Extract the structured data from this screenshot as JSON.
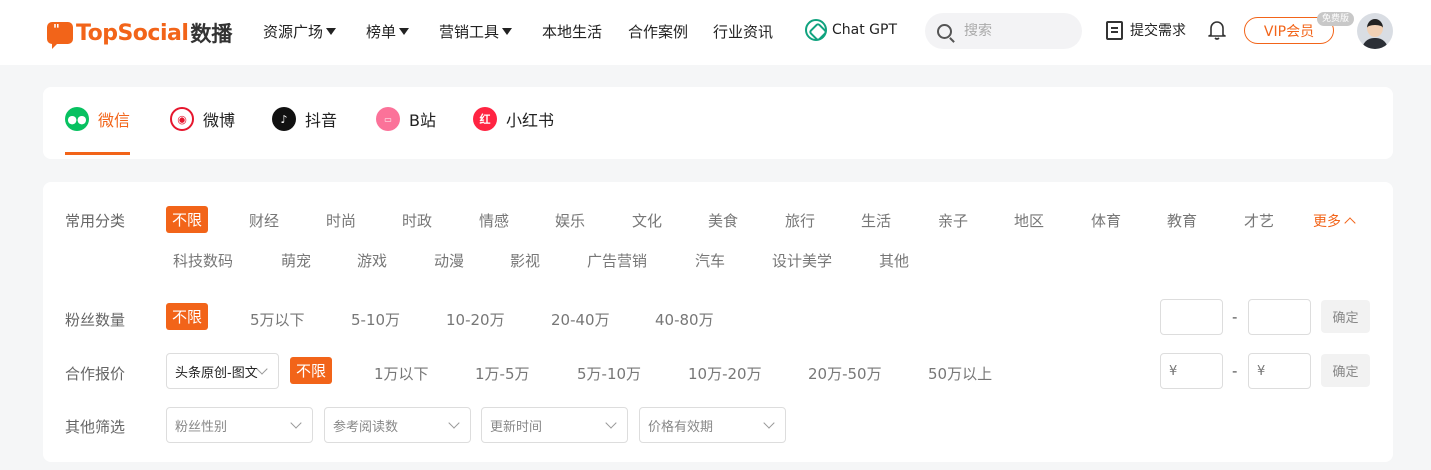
{
  "header": {
    "logo_mark": "\"",
    "logo_text": "TopSocial",
    "logo_sub": "数播",
    "nav": [
      "资源广场",
      "榜单",
      "营销工具",
      "本地生活",
      "合作案例",
      "行业资讯"
    ],
    "chatgpt": "Chat GPT",
    "search_placeholder": "搜索",
    "submit_label": "提交需求",
    "vip_label": "VIP会员",
    "vip_badge": "免费版"
  },
  "platform_tabs": [
    {
      "label": "微信",
      "icon": "wechat-icon",
      "color": "#07c160"
    },
    {
      "label": "微博",
      "icon": "weibo-icon",
      "color": "#e6162d"
    },
    {
      "label": "抖音",
      "icon": "douyin-icon",
      "color": "#111111"
    },
    {
      "label": "B站",
      "icon": "bilibili-icon",
      "color": "#fb7299"
    },
    {
      "label": "小红书",
      "icon": "xiaohongshu-icon",
      "color": "#ff2442"
    }
  ],
  "filters": {
    "category_label": "常用分类",
    "categories_row1": [
      "不限",
      "财经",
      "时尚",
      "时政",
      "情感",
      "娱乐",
      "文化",
      "美食",
      "旅行",
      "生活",
      "亲子",
      "地区",
      "体育",
      "教育",
      "才艺"
    ],
    "categories_row2": [
      "科技数码",
      "萌宠",
      "游戏",
      "动漫",
      "影视",
      "广告营销",
      "汽车",
      "设计美学",
      "其他"
    ],
    "more_label": "更多",
    "fans_label": "粉丝数量",
    "fans_options": [
      "不限",
      "5万以下",
      "5-10万",
      "10-20万",
      "20-40万",
      "40-80万"
    ],
    "price_label": "合作报价",
    "price_type_value": "头条原创-图文",
    "price_options": [
      "不限",
      "1万以下",
      "1万-5万",
      "5万-10万",
      "10万-20万",
      "20万-50万",
      "50万以上"
    ],
    "range_dash": "-",
    "currency_placeholder": "¥",
    "confirm_label": "确定",
    "other_label": "其他筛选",
    "other_selects": [
      "粉丝性别",
      "参考阅读数",
      "更新时间",
      "价格有效期"
    ]
  },
  "colors": {
    "accent": "#f26419"
  }
}
